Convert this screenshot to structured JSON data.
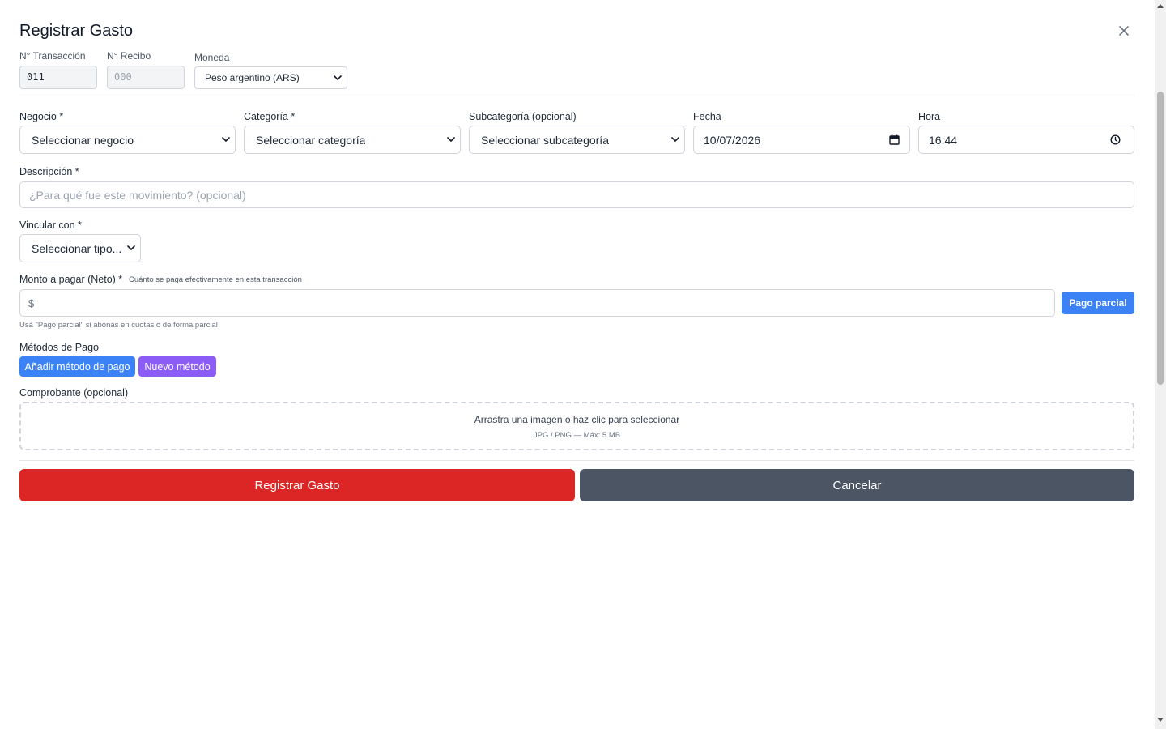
{
  "modal": {
    "title": "Registrar Gasto",
    "close_label": "×"
  },
  "header_fields": {
    "transaction_label": "N° Transacción",
    "transaction_value": "011",
    "receipt_label": "N° Recibo",
    "receipt_placeholder": "000",
    "currency_label": "Moneda",
    "currency_selected": "Peso argentino (ARS)"
  },
  "fields": {
    "business_label": "Negocio *",
    "business_selected": "Seleccionar negocio",
    "category_label": "Categoría *",
    "category_selected": "Seleccionar categoría",
    "subcategory_label": "Subcategoría (opcional)",
    "subcategory_selected": "Seleccionar subcategoría",
    "date_label": "Fecha",
    "date_value": "10/07/2026",
    "time_label": "Hora",
    "time_value": "16:44",
    "description_label": "Descripción *",
    "description_placeholder": "¿Para qué fue este movimiento? (opcional)",
    "link_label": "Vincular con *",
    "link_selected": "Seleccionar tipo..."
  },
  "amount": {
    "label": "Monto a pagar (Neto) *",
    "hint": "Cuánto se paga efectivamente en esta transacción",
    "currency_symbol": "$",
    "partial_button": "Pago parcial",
    "help": "Usá \"Pago parcial\" si abonás en cuotas o de forma parcial"
  },
  "payment_methods": {
    "label": "Métodos de Pago",
    "add_button": "Añadir método de pago",
    "new_button": "Nuevo método"
  },
  "receipt_upload": {
    "label": "Comprobante (opcional)",
    "main_text": "Arrastra una imagen o haz clic para seleccionar",
    "sub_text": "JPG / PNG — Máx: 5 MB"
  },
  "actions": {
    "submit": "Registrar Gasto",
    "cancel": "Cancelar"
  },
  "colors": {
    "submit": "#dc2626",
    "cancel": "#4b5563",
    "primary": "#3b82f6",
    "secondary": "#8b5cf6"
  },
  "icons": {
    "close": "close-icon",
    "select": "chevron-down-icon",
    "date": "calendar-icon",
    "time": "clock-icon"
  }
}
